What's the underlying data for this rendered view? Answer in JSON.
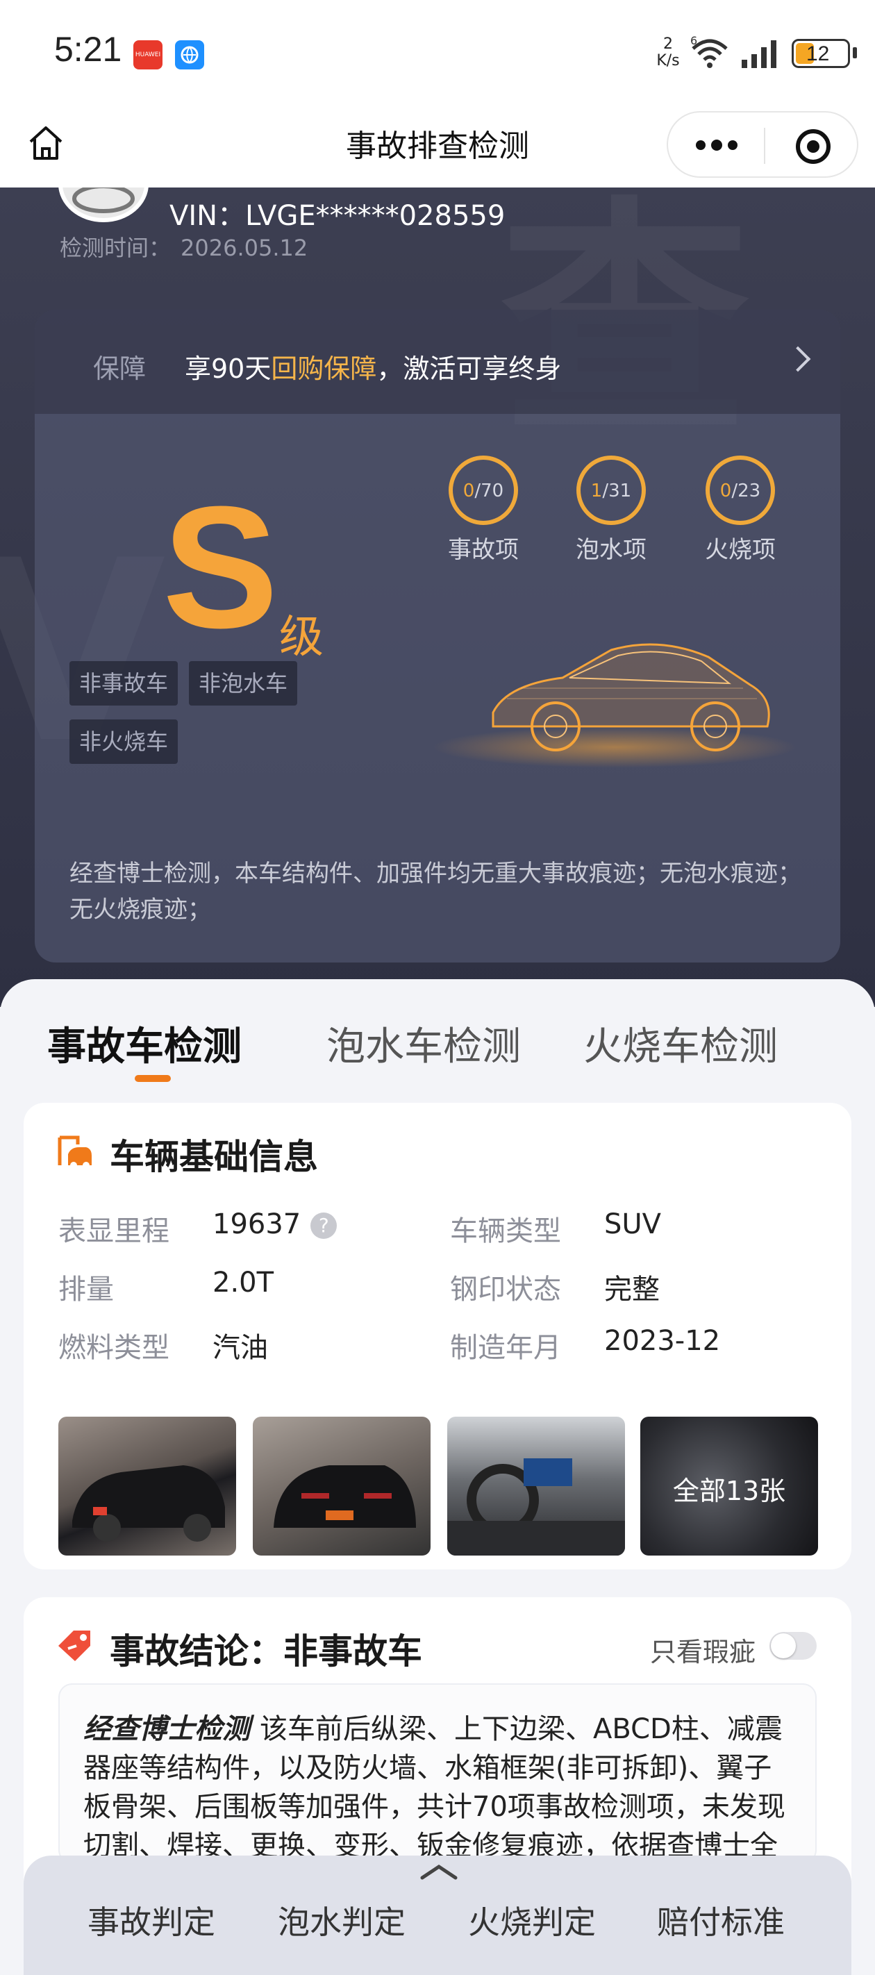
{
  "status_bar": {
    "time": "5:21",
    "net_speed_value": "2",
    "net_speed_unit": "K/s",
    "wifi_label": "6",
    "battery": "12",
    "icons": [
      "huawei-app-icon",
      "browser-app-icon",
      "wifi-icon",
      "signal-icon",
      "battery-icon"
    ]
  },
  "nav": {
    "title": "事故排查检测"
  },
  "vehicle": {
    "vin": "VIN：LVGE******028559",
    "inspect_time_label": "检测时间：",
    "inspect_time": "2026.05.12"
  },
  "guarantee": {
    "label": "保障",
    "text_before": "享90天",
    "text_highlight": "回购保障",
    "text_after": "，激活可享终身"
  },
  "grade": {
    "letter": "S",
    "suffix": "级"
  },
  "checks": [
    {
      "value": "0",
      "total": "/70",
      "label": "事故项"
    },
    {
      "value": "1",
      "total": "/31",
      "label": "泡水项"
    },
    {
      "value": "0",
      "total": "/23",
      "label": "火烧项"
    }
  ],
  "tags": [
    "非事故车",
    "非泡水车",
    "非火烧车"
  ],
  "summary": "经查博士检测，本车结构件、加强件均无重大事故痕迹；无泡水痕迹；无火烧痕迹；",
  "tabs": [
    {
      "label": "事故车检测",
      "active": true
    },
    {
      "label": "泡水车检测",
      "active": false
    },
    {
      "label": "火烧车检测",
      "active": false
    }
  ],
  "basic_info": {
    "title": "车辆基础信息",
    "rows": [
      {
        "k1": "表显里程",
        "v1": "19637",
        "k2": "车辆类型",
        "v2": "SUV"
      },
      {
        "k1": "排量",
        "v1": "2.0T",
        "k2": "钢印状态",
        "v2": "完整"
      },
      {
        "k1": "燃料类型",
        "v1": "汽油",
        "k2": "制造年月",
        "v2": "2023-12"
      }
    ],
    "help_glyph": "?",
    "photos_more": "全部13张"
  },
  "conclusion": {
    "title": "事故结论：非事故车",
    "toggle_label": "只看瑕疵",
    "toggle_on": false,
    "brand": "经查博士检测",
    "text": "该车前后纵梁、上下边梁、ABCD柱、减震器座等结构件，以及防火墙、水箱框架(非可拆卸)、翼子板骨架、后围板等加强件，共计70项事故检测项，未发现切割、焊接、更换、变形、钣金修复痕迹，依据查博士全"
  },
  "bottom_tabs": [
    "事故判定",
    "泡水判定",
    "火烧判定",
    "赔付标准"
  ],
  "colors": {
    "accent": "#f5a43a",
    "tab_indicator": "#f07a1a",
    "hero_bg": "#363849"
  }
}
